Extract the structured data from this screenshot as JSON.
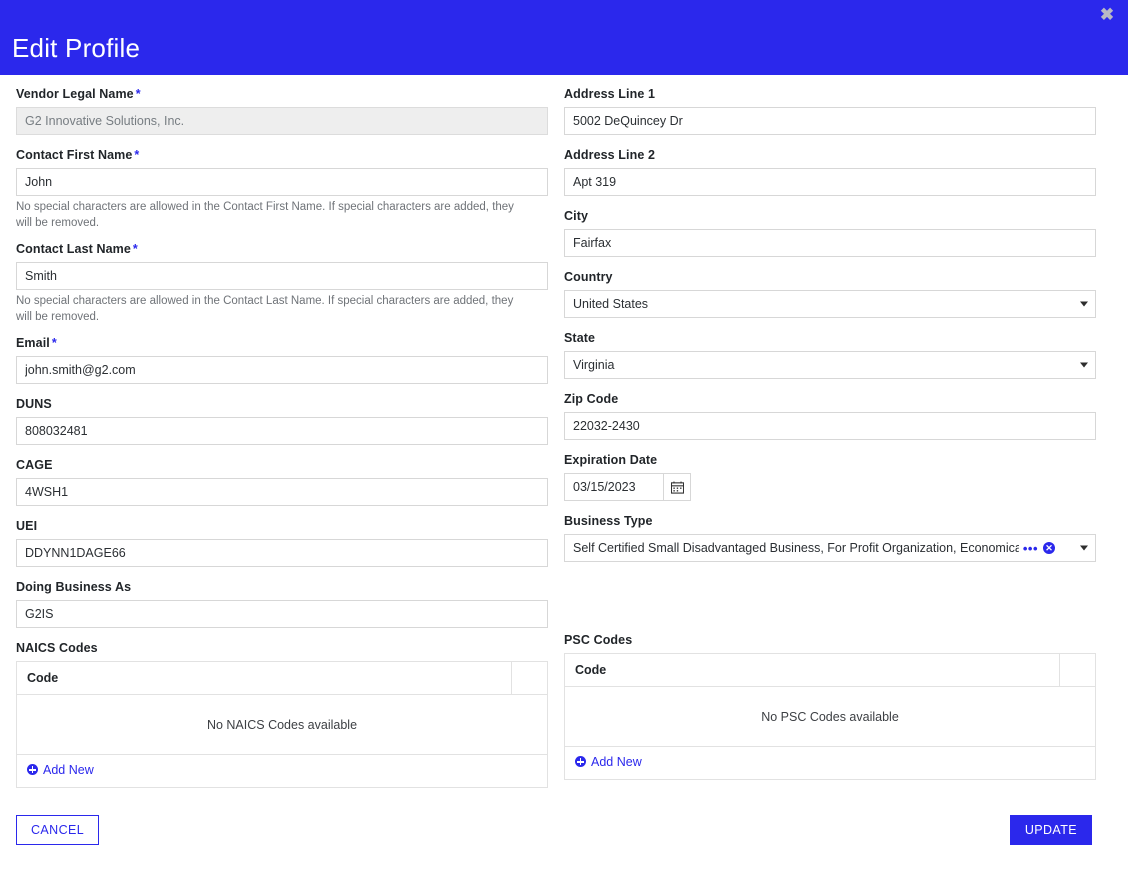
{
  "header": {
    "title": "Edit Profile",
    "close_label": "✖",
    "bg_color": "#2b28ec"
  },
  "left_column": {
    "vendor_legal_name": {
      "label": "Vendor Legal Name",
      "required": "*",
      "value": "G2 Innovative Solutions, Inc.",
      "disabled": true
    },
    "contact_first_name": {
      "label": "Contact First Name",
      "required": "*",
      "value": "John",
      "helper": "No special characters are allowed in the Contact First Name. If special characters are added, they will be removed."
    },
    "contact_last_name": {
      "label": "Contact Last Name",
      "required": "*",
      "value": "Smith",
      "helper": "No special characters are allowed in the Contact Last Name. If special characters are added, they will be removed."
    },
    "email": {
      "label": "Email",
      "required": "*",
      "value": "john.smith@g2.com"
    },
    "duns": {
      "label": "DUNS",
      "value": "808032481"
    },
    "cage": {
      "label": "CAGE",
      "value": "4WSH1"
    },
    "uei": {
      "label": "UEI",
      "value": "DDYNN1DAGE66"
    },
    "doing_business_as": {
      "label": "Doing Business As",
      "value": "G2IS"
    },
    "naics_codes": {
      "label": "NAICS Codes",
      "column_header": "Code",
      "empty_message": "No NAICS Codes available",
      "add_new_label": "Add New",
      "rows": []
    }
  },
  "right_column": {
    "address_line_1": {
      "label": "Address Line 1",
      "value": "5002 DeQuincey Dr"
    },
    "address_line_2": {
      "label": "Address Line 2",
      "value": "Apt 319"
    },
    "city": {
      "label": "City",
      "value": "Fairfax"
    },
    "country": {
      "label": "Country",
      "value": "United States"
    },
    "state": {
      "label": "State",
      "value": "Virginia"
    },
    "zip_code": {
      "label": "Zip Code",
      "value": "22032-2430"
    },
    "expiration_date": {
      "label": "Expiration Date",
      "value": "03/15/2023"
    },
    "business_type": {
      "label": "Business Type",
      "value": "Self Certified Small Disadvantaged Business, For Profit Organization, Economically Disadvanta",
      "overflow_indicator": "•••",
      "clear_label": "✕"
    },
    "psc_codes": {
      "label": "PSC Codes",
      "column_header": "Code",
      "empty_message": "No PSC Codes available",
      "add_new_label": "Add New",
      "rows": []
    }
  },
  "footer": {
    "cancel_label": "CANCEL",
    "update_label": "UPDATE"
  },
  "colors": {
    "accent": "#2b28ec",
    "border": "#d7d7d7",
    "disabled_bg": "#eeeeee",
    "helper_text": "#6f7378"
  }
}
